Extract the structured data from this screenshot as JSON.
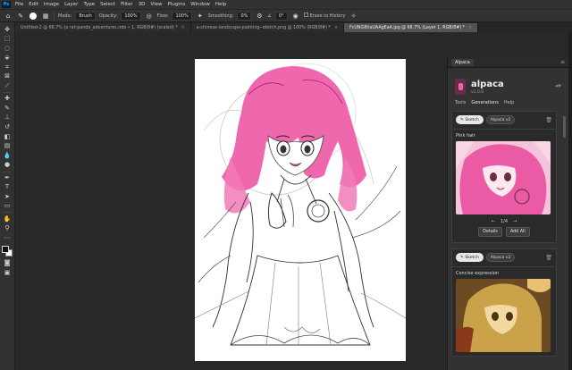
{
  "menubar": {
    "logo": "Ps",
    "items": [
      "File",
      "Edit",
      "Image",
      "Layer",
      "Type",
      "Select",
      "Filter",
      "3D",
      "View",
      "Plugins",
      "Window",
      "Help"
    ]
  },
  "options": {
    "mode_label": "Mode:",
    "mode_value": "Brush",
    "opacity_label": "Opacity:",
    "opacity_value": "100%",
    "flow_label": "Flow:",
    "flow_value": "100%",
    "smoothing_label": "Smoothing:",
    "smoothing_value": "0%",
    "angle_value": "0°",
    "erase_history_label": "Erase to History"
  },
  "tabs": [
    {
      "label": "Untitled-2 @ 66.7% (a rat-panda_adventures.nde • 1, RGB/8#) (scaled) *",
      "active": false
    },
    {
      "label": "a-chinese-landscape-painting--sketch.png @ 100% (RGB/8#) *",
      "active": false
    },
    {
      "label": "FcUNG8tiaUAAgEaA.jpg @ 66.7% (Layer 1, RGB/8#) *",
      "active": true
    }
  ],
  "panel": {
    "tab_label": "Alpaca",
    "brand_name": "alpaca",
    "brand_version": "v1.0.0",
    "nav": [
      "Tools",
      "Generations",
      "Help"
    ],
    "cards": [
      {
        "chip_mode": "Sketch",
        "chip_model": "Alpaca v2",
        "title": "Pink hair",
        "pager": "1/4",
        "btn_details": "Details",
        "btn_add": "Add All"
      },
      {
        "chip_mode": "Sketch",
        "chip_model": "Alpaca v2",
        "title": "Concise expression"
      }
    ]
  },
  "colors": {
    "hair_pink": "#ee5aa6",
    "accent_fg": "#111111",
    "accent_bg": "#ffffff"
  }
}
